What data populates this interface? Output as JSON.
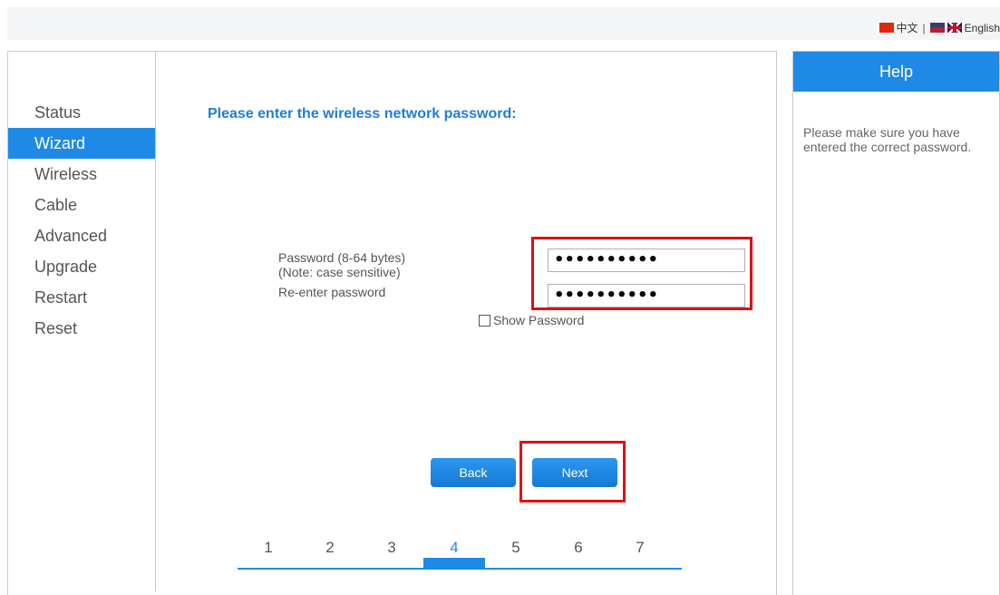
{
  "language": {
    "chinese_label": "中文",
    "separator": "|",
    "english_label": "English"
  },
  "sidebar": {
    "items": [
      {
        "label": "Status"
      },
      {
        "label": "Wizard",
        "active": true
      },
      {
        "label": "Wireless"
      },
      {
        "label": "Cable"
      },
      {
        "label": "Advanced"
      },
      {
        "label": "Upgrade"
      },
      {
        "label": "Restart"
      },
      {
        "label": "Reset"
      }
    ]
  },
  "main": {
    "title": "Please enter the wireless network password:",
    "password_label": "Password (8-64 bytes)",
    "password_note": "(Note: case sensitive)",
    "reenter_label": "Re-enter password",
    "password_value": "••••••••••",
    "reenter_value": "••••••••••",
    "show_password_label": "Show Password",
    "show_password_checked": false,
    "back_label": "Back",
    "next_label": "Next"
  },
  "steps": {
    "items": [
      "1",
      "2",
      "3",
      "4",
      "5",
      "6",
      "7"
    ],
    "current": "4"
  },
  "help": {
    "title": "Help",
    "text": "Please make sure you have entered the correct password."
  },
  "colors": {
    "accent": "#1e8ae6",
    "highlight_box": "#e01010"
  }
}
